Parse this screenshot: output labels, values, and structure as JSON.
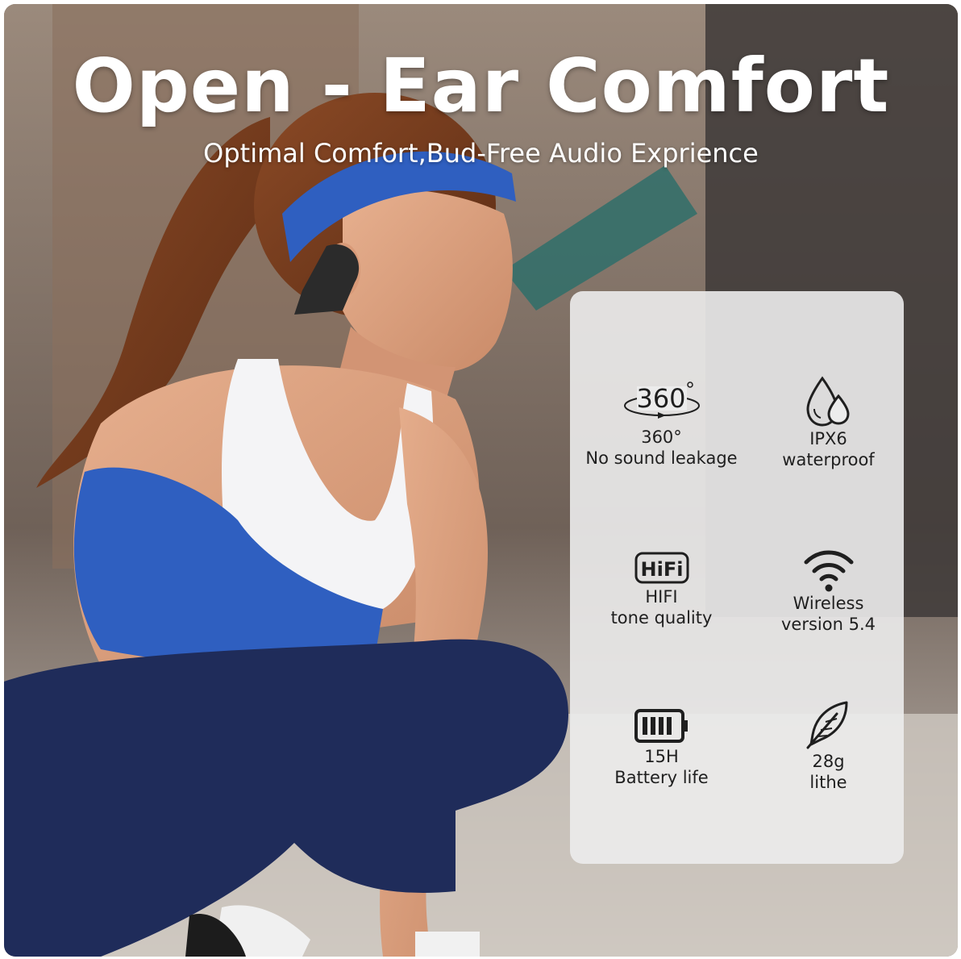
{
  "headline": {
    "title": "Open - Ear Comfort",
    "subtitle": "Optimal Comfort,Bud-Free Audio Exprience"
  },
  "features": [
    {
      "icon": "360-degree-icon",
      "line1": "360°",
      "line2": "No sound leakage"
    },
    {
      "icon": "water-drops-icon",
      "line1": "IPX6",
      "line2": "waterproof"
    },
    {
      "icon": "hifi-icon",
      "line1": "HIFI",
      "line2": "tone quality"
    },
    {
      "icon": "wifi-icon",
      "line1": "Wireless",
      "line2": "version 5.4"
    },
    {
      "icon": "battery-icon",
      "line1": "15H",
      "line2": "Battery life"
    },
    {
      "icon": "feather-icon",
      "line1": "28g",
      "line2": "lithe"
    }
  ],
  "icon_text": {
    "deg360": "360",
    "hifi": "HiFi"
  },
  "colors": {
    "headband_blue": "#2f5fc0",
    "legging_navy": "#1f2c5a",
    "panel_bg": "#ececec"
  }
}
